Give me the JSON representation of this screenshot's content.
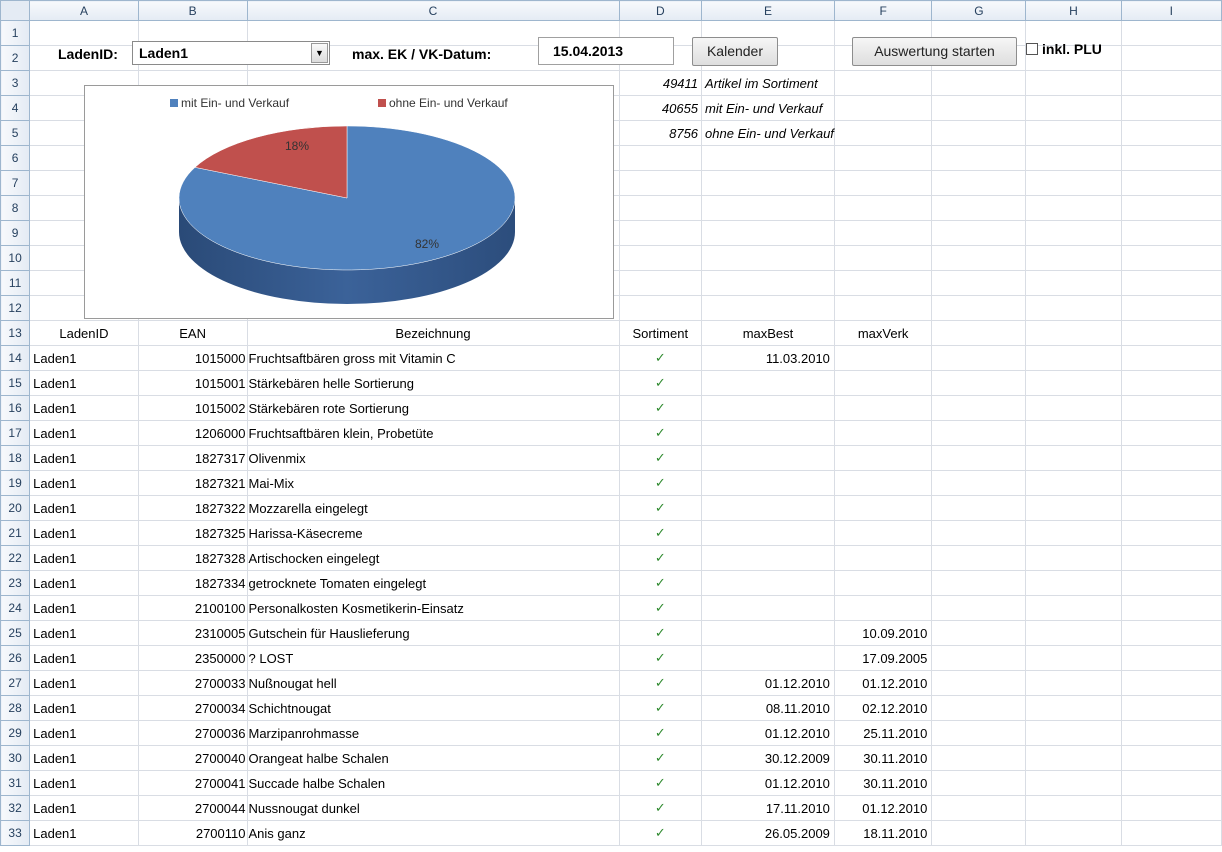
{
  "columns": [
    "A",
    "B",
    "C",
    "D",
    "E",
    "F",
    "G",
    "H",
    "I"
  ],
  "controls": {
    "laden_label": "LadenID:",
    "laden_value": "Laden1",
    "datum_label": "max. EK / VK-Datum:",
    "datum_value": "15.04.2013",
    "kalender_button": "Kalender",
    "auswertung_button": "Auswertung starten",
    "plu_checkbox_label": "inkl. PLU"
  },
  "stats": [
    {
      "num": "49411",
      "text": "Artikel im Sortiment"
    },
    {
      "num": "40655",
      "text": "mit Ein- und Verkauf"
    },
    {
      "num": "8756",
      "text": "ohne Ein- und Verkauf"
    }
  ],
  "chart_data": {
    "type": "pie",
    "categories": [
      "mit Ein- und Verkauf",
      "ohne Ein- und Verkauf"
    ],
    "values": [
      82,
      18
    ],
    "labels": [
      "82%",
      "18%"
    ],
    "colors": [
      "#4f81bd",
      "#c0504d"
    ],
    "legend": "top"
  },
  "table": {
    "headers": [
      "LadenID",
      "EAN",
      "Bezeichnung",
      "Sortiment",
      "maxBest",
      "maxVerk"
    ],
    "check_glyph": "✓",
    "rows": [
      {
        "n": "14",
        "a": "Laden1",
        "b": "1015000",
        "c": "Fruchtsaftbären gross mit Vitamin C",
        "e": "11.03.2010",
        "f": ""
      },
      {
        "n": "15",
        "a": "Laden1",
        "b": "1015001",
        "c": "Stärkebären helle Sortierung",
        "e": "",
        "f": ""
      },
      {
        "n": "16",
        "a": "Laden1",
        "b": "1015002",
        "c": "Stärkebären rote Sortierung",
        "e": "",
        "f": ""
      },
      {
        "n": "17",
        "a": "Laden1",
        "b": "1206000",
        "c": "Fruchtsaftbären klein, Probetüte",
        "e": "",
        "f": ""
      },
      {
        "n": "18",
        "a": "Laden1",
        "b": "1827317",
        "c": "Olivenmix",
        "e": "",
        "f": ""
      },
      {
        "n": "19",
        "a": "Laden1",
        "b": "1827321",
        "c": "Mai-Mix",
        "e": "",
        "f": ""
      },
      {
        "n": "20",
        "a": "Laden1",
        "b": "1827322",
        "c": "Mozzarella eingelegt",
        "e": "",
        "f": ""
      },
      {
        "n": "21",
        "a": "Laden1",
        "b": "1827325",
        "c": "Harissa-Käsecreme",
        "e": "",
        "f": ""
      },
      {
        "n": "22",
        "a": "Laden1",
        "b": "1827328",
        "c": "Artischocken eingelegt",
        "e": "",
        "f": ""
      },
      {
        "n": "23",
        "a": "Laden1",
        "b": "1827334",
        "c": "getrocknete Tomaten eingelegt",
        "e": "",
        "f": ""
      },
      {
        "n": "24",
        "a": "Laden1",
        "b": "2100100",
        "c": "Personalkosten Kosmetikerin-Einsatz",
        "e": "",
        "f": ""
      },
      {
        "n": "25",
        "a": "Laden1",
        "b": "2310005",
        "c": "Gutschein für Hauslieferung",
        "e": "",
        "f": "10.09.2010"
      },
      {
        "n": "26",
        "a": "Laden1",
        "b": "2350000",
        "c": "? LOST",
        "e": "",
        "f": "17.09.2005"
      },
      {
        "n": "27",
        "a": "Laden1",
        "b": "2700033",
        "c": "Nußnougat hell",
        "e": "01.12.2010",
        "f": "01.12.2010"
      },
      {
        "n": "28",
        "a": "Laden1",
        "b": "2700034",
        "c": "Schichtnougat",
        "e": "08.11.2010",
        "f": "02.12.2010"
      },
      {
        "n": "29",
        "a": "Laden1",
        "b": "2700036",
        "c": "Marzipanrohmasse",
        "e": "01.12.2010",
        "f": "25.11.2010"
      },
      {
        "n": "30",
        "a": "Laden1",
        "b": "2700040",
        "c": "Orangeat halbe Schalen",
        "e": "30.12.2009",
        "f": "30.11.2010"
      },
      {
        "n": "31",
        "a": "Laden1",
        "b": "2700041",
        "c": "Succade halbe Schalen",
        "e": "01.12.2010",
        "f": "30.11.2010"
      },
      {
        "n": "32",
        "a": "Laden1",
        "b": "2700044",
        "c": "Nussnougat dunkel",
        "e": "17.11.2010",
        "f": "01.12.2010"
      },
      {
        "n": "33",
        "a": "Laden1",
        "b": "2700110",
        "c": "Anis ganz",
        "e": "26.05.2009",
        "f": "18.11.2010"
      }
    ]
  }
}
